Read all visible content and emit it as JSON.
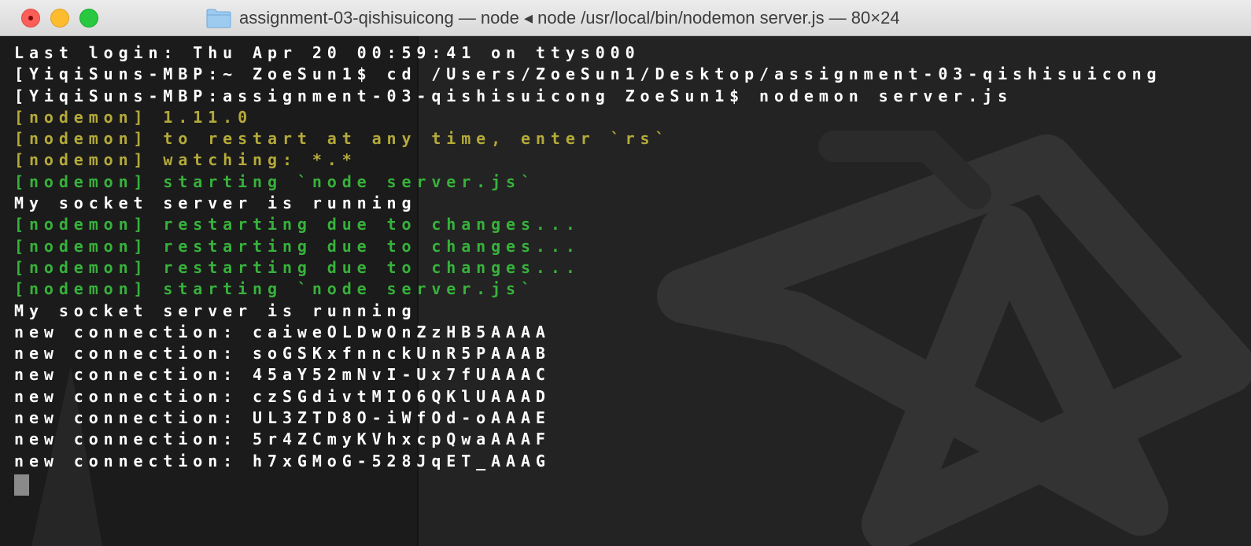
{
  "window": {
    "title": "assignment-03-qishisuicong — node ◂ node /usr/local/bin/nodemon server.js — 80×24",
    "traffic_lights": [
      "close",
      "minimize",
      "zoom"
    ],
    "title_icon": "folder-icon"
  },
  "colors": {
    "white": "#ffffff",
    "yellow": "#b4aa3a",
    "green": "#37b23b",
    "background": "#1b1b1b"
  },
  "terminal": {
    "lines": [
      {
        "text": "Last login: Thu Apr 20 00:59:41 on ttys000",
        "color": "#ffffff"
      },
      {
        "text": "[YiqiSuns-MBP:~ ZoeSun1$ cd /Users/ZoeSun1/Desktop/assignment-03-qishisuicong",
        "color": "#ffffff"
      },
      {
        "text": "[YiqiSuns-MBP:assignment-03-qishisuicong ZoeSun1$ nodemon server.js",
        "color": "#ffffff"
      },
      {
        "text": "[nodemon] 1.11.0",
        "color": "#b4aa3a"
      },
      {
        "text": "[nodemon] to restart at any time, enter `rs`",
        "color": "#b4aa3a"
      },
      {
        "text": "[nodemon] watching: *.*",
        "color": "#b4aa3a"
      },
      {
        "text": "[nodemon] starting `node server.js`",
        "color": "#37b23b"
      },
      {
        "text": "My socket server is running",
        "color": "#ffffff"
      },
      {
        "text": "[nodemon] restarting due to changes...",
        "color": "#37b23b"
      },
      {
        "text": "[nodemon] restarting due to changes...",
        "color": "#37b23b"
      },
      {
        "text": "[nodemon] restarting due to changes...",
        "color": "#37b23b"
      },
      {
        "text": "[nodemon] starting `node server.js`",
        "color": "#37b23b"
      },
      {
        "text": "My socket server is running",
        "color": "#ffffff"
      },
      {
        "text": "new connection: caiweOLDwOnZzHB5AAAA",
        "color": "#ffffff"
      },
      {
        "text": "new connection: soGSKxfnnckUnR5PAAAB",
        "color": "#ffffff"
      },
      {
        "text": "new connection: 45aY52mNvI-Ux7fUAAAC",
        "color": "#ffffff"
      },
      {
        "text": "new connection: czSGdivtMIO6QKlUAAAD",
        "color": "#ffffff"
      },
      {
        "text": "new connection: UL3ZTD8O-iWfOd-oAAAE",
        "color": "#ffffff"
      },
      {
        "text": "new connection: 5r4ZCmyKVhxcpQwaAAAF",
        "color": "#ffffff"
      },
      {
        "text": "new connection: h7xGMoG-528JqET_AAAG",
        "color": "#ffffff"
      }
    ]
  }
}
